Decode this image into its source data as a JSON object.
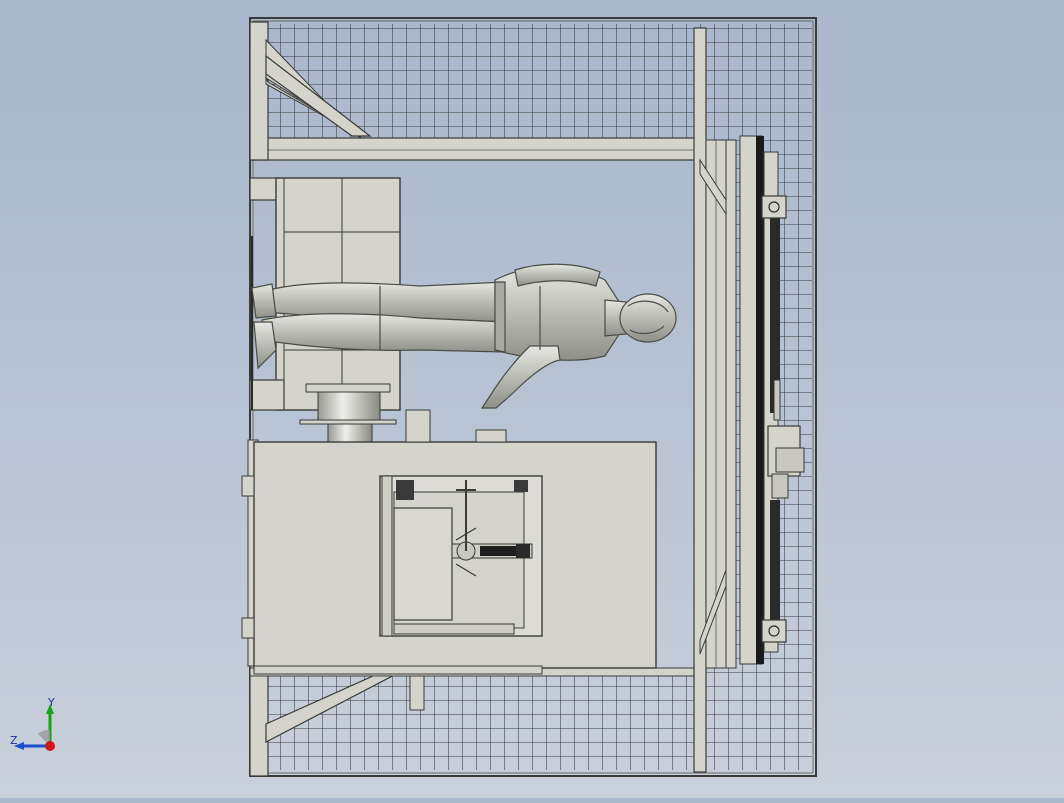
{
  "viewport": {
    "background_top": "#a9b6cc",
    "background_bottom": "#c9d0db",
    "part_fill": "#d4d4cc",
    "part_stroke": "#3a3a36",
    "mannequin_fill": "#c2c4bd"
  },
  "triad": {
    "x_color": "#d01818",
    "y_color": "#18a018",
    "z_color": "#1a4fd0",
    "y_label": "Y",
    "z_label": "Z"
  }
}
